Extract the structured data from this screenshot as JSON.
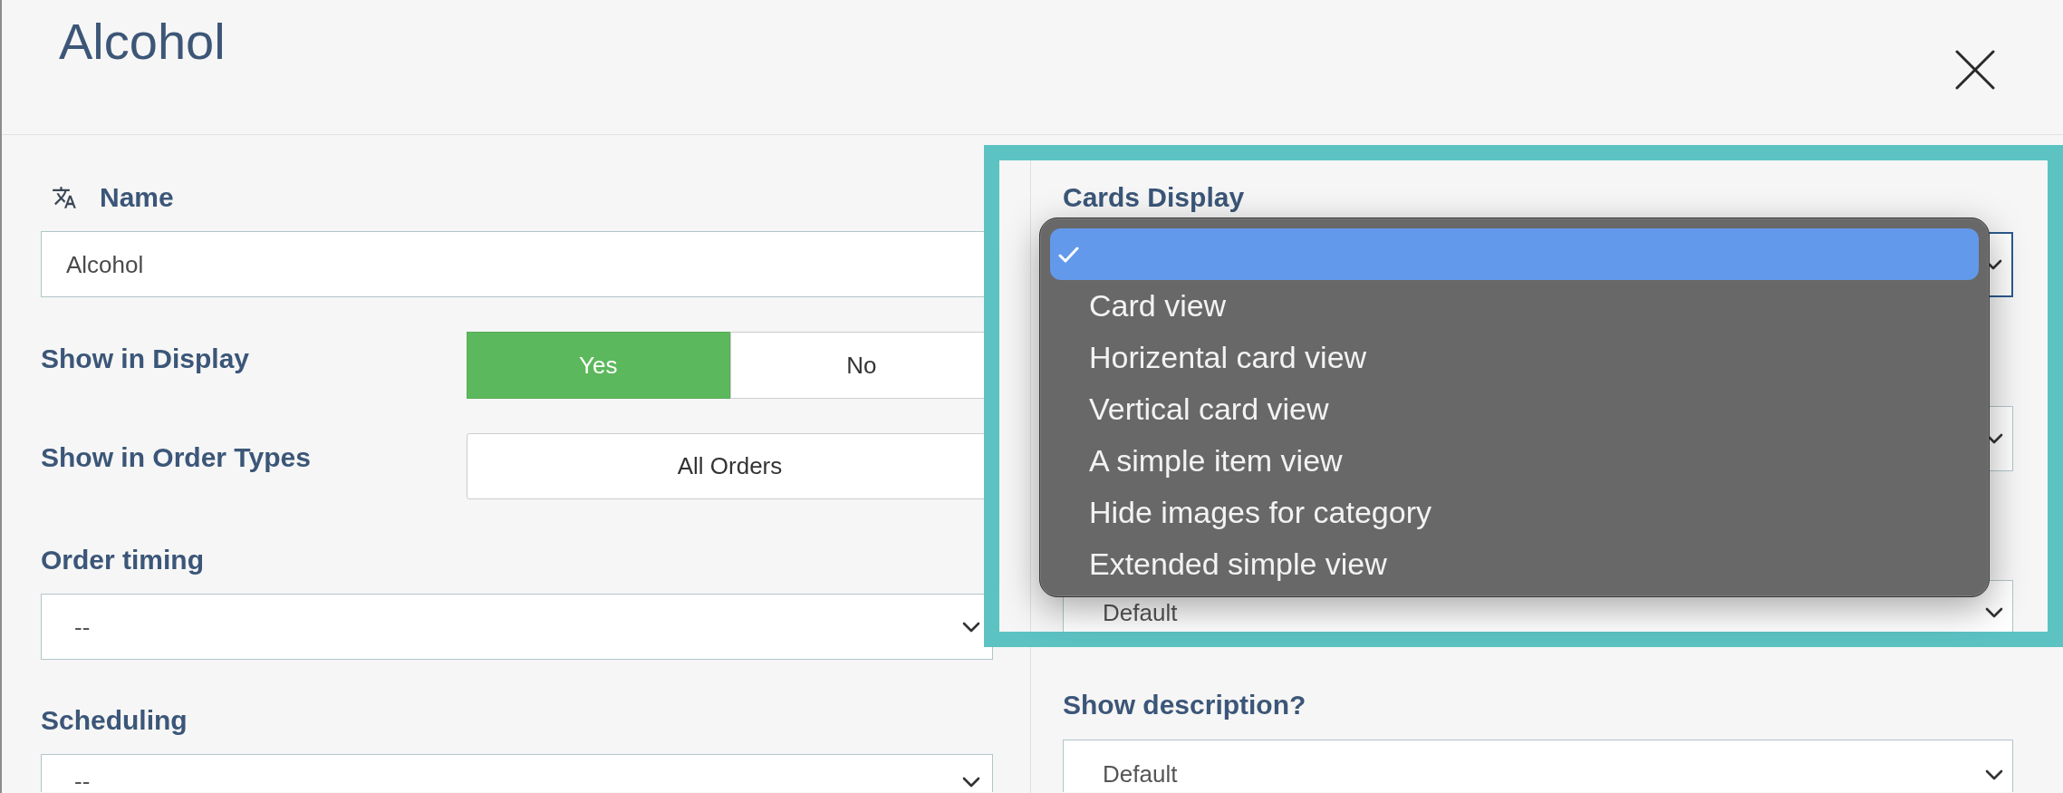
{
  "dialog": {
    "title": "Alcohol"
  },
  "form": {
    "left": [
      {
        "kind": "text",
        "label": "Name",
        "translatable": true,
        "value": "Alcohol",
        "focused": false
      },
      {
        "kind": "toggle",
        "label": "Show in Display",
        "focused": false,
        "options": [
          {
            "label": "Yes",
            "selected": true
          },
          {
            "label": "No",
            "selected": false
          }
        ]
      },
      {
        "kind": "button",
        "label": "Show in Order Types",
        "value": "All Orders",
        "focused": false
      },
      {
        "kind": "select",
        "label": "Order timing",
        "value": "--",
        "focused": false
      },
      {
        "kind": "select",
        "label": "Scheduling",
        "value": "--",
        "focused": false
      }
    ],
    "right": [
      {
        "kind": "select",
        "label": "Cards Display",
        "focused": true
      },
      {
        "kind": "select",
        "focused": false
      },
      {
        "kind": "select",
        "value": "Default",
        "focused": false
      },
      {
        "kind": "select",
        "label": "Show description?",
        "value": "Default",
        "focused": false
      }
    ]
  },
  "dropdown": {
    "options": [
      {
        "selected": true
      },
      {
        "label": "Card view",
        "selected": false
      },
      {
        "label": "Horizental card view",
        "selected": false
      },
      {
        "label": "Vertical card view",
        "selected": false
      },
      {
        "label": "A simple item view",
        "selected": false
      },
      {
        "label": "Hide images for category",
        "selected": false
      },
      {
        "label": "Extended simple view",
        "selected": false
      }
    ]
  }
}
